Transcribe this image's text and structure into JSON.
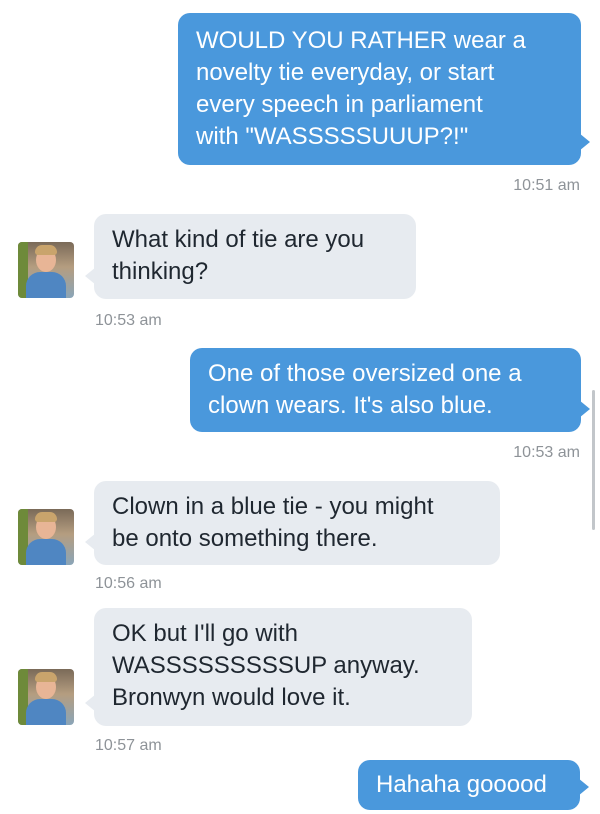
{
  "thread": {
    "messages": [
      {
        "dir": "out",
        "text": "WOULD YOU RATHER wear a\nnovelty tie everyday, or start\nevery speech in parliament\nwith \"WASSSSSUUUP?!\"",
        "time": "10:51 am"
      },
      {
        "dir": "in",
        "text": "What kind of tie are you\nthinking?",
        "time": "10:53 am"
      },
      {
        "dir": "out",
        "text": "One of those oversized one a\nclown wears. It's also blue.",
        "time": "10:53 am"
      },
      {
        "dir": "in",
        "text": "Clown in a blue tie - you might\nbe onto something there.",
        "time": "10:56 am"
      },
      {
        "dir": "in",
        "text": "OK but I'll go with\nWASSSSSSSSSUP anyway.\nBronwyn would love it.",
        "time": "10:57 am"
      },
      {
        "dir": "out",
        "text": "Hahaha gooood",
        "time": ""
      }
    ]
  },
  "colors": {
    "outgoing_bubble": "#4a98dc",
    "incoming_bubble": "#e7ebf0",
    "timestamp": "#8e9398"
  },
  "icons": {
    "contact_avatar": "contact-avatar-photo"
  }
}
